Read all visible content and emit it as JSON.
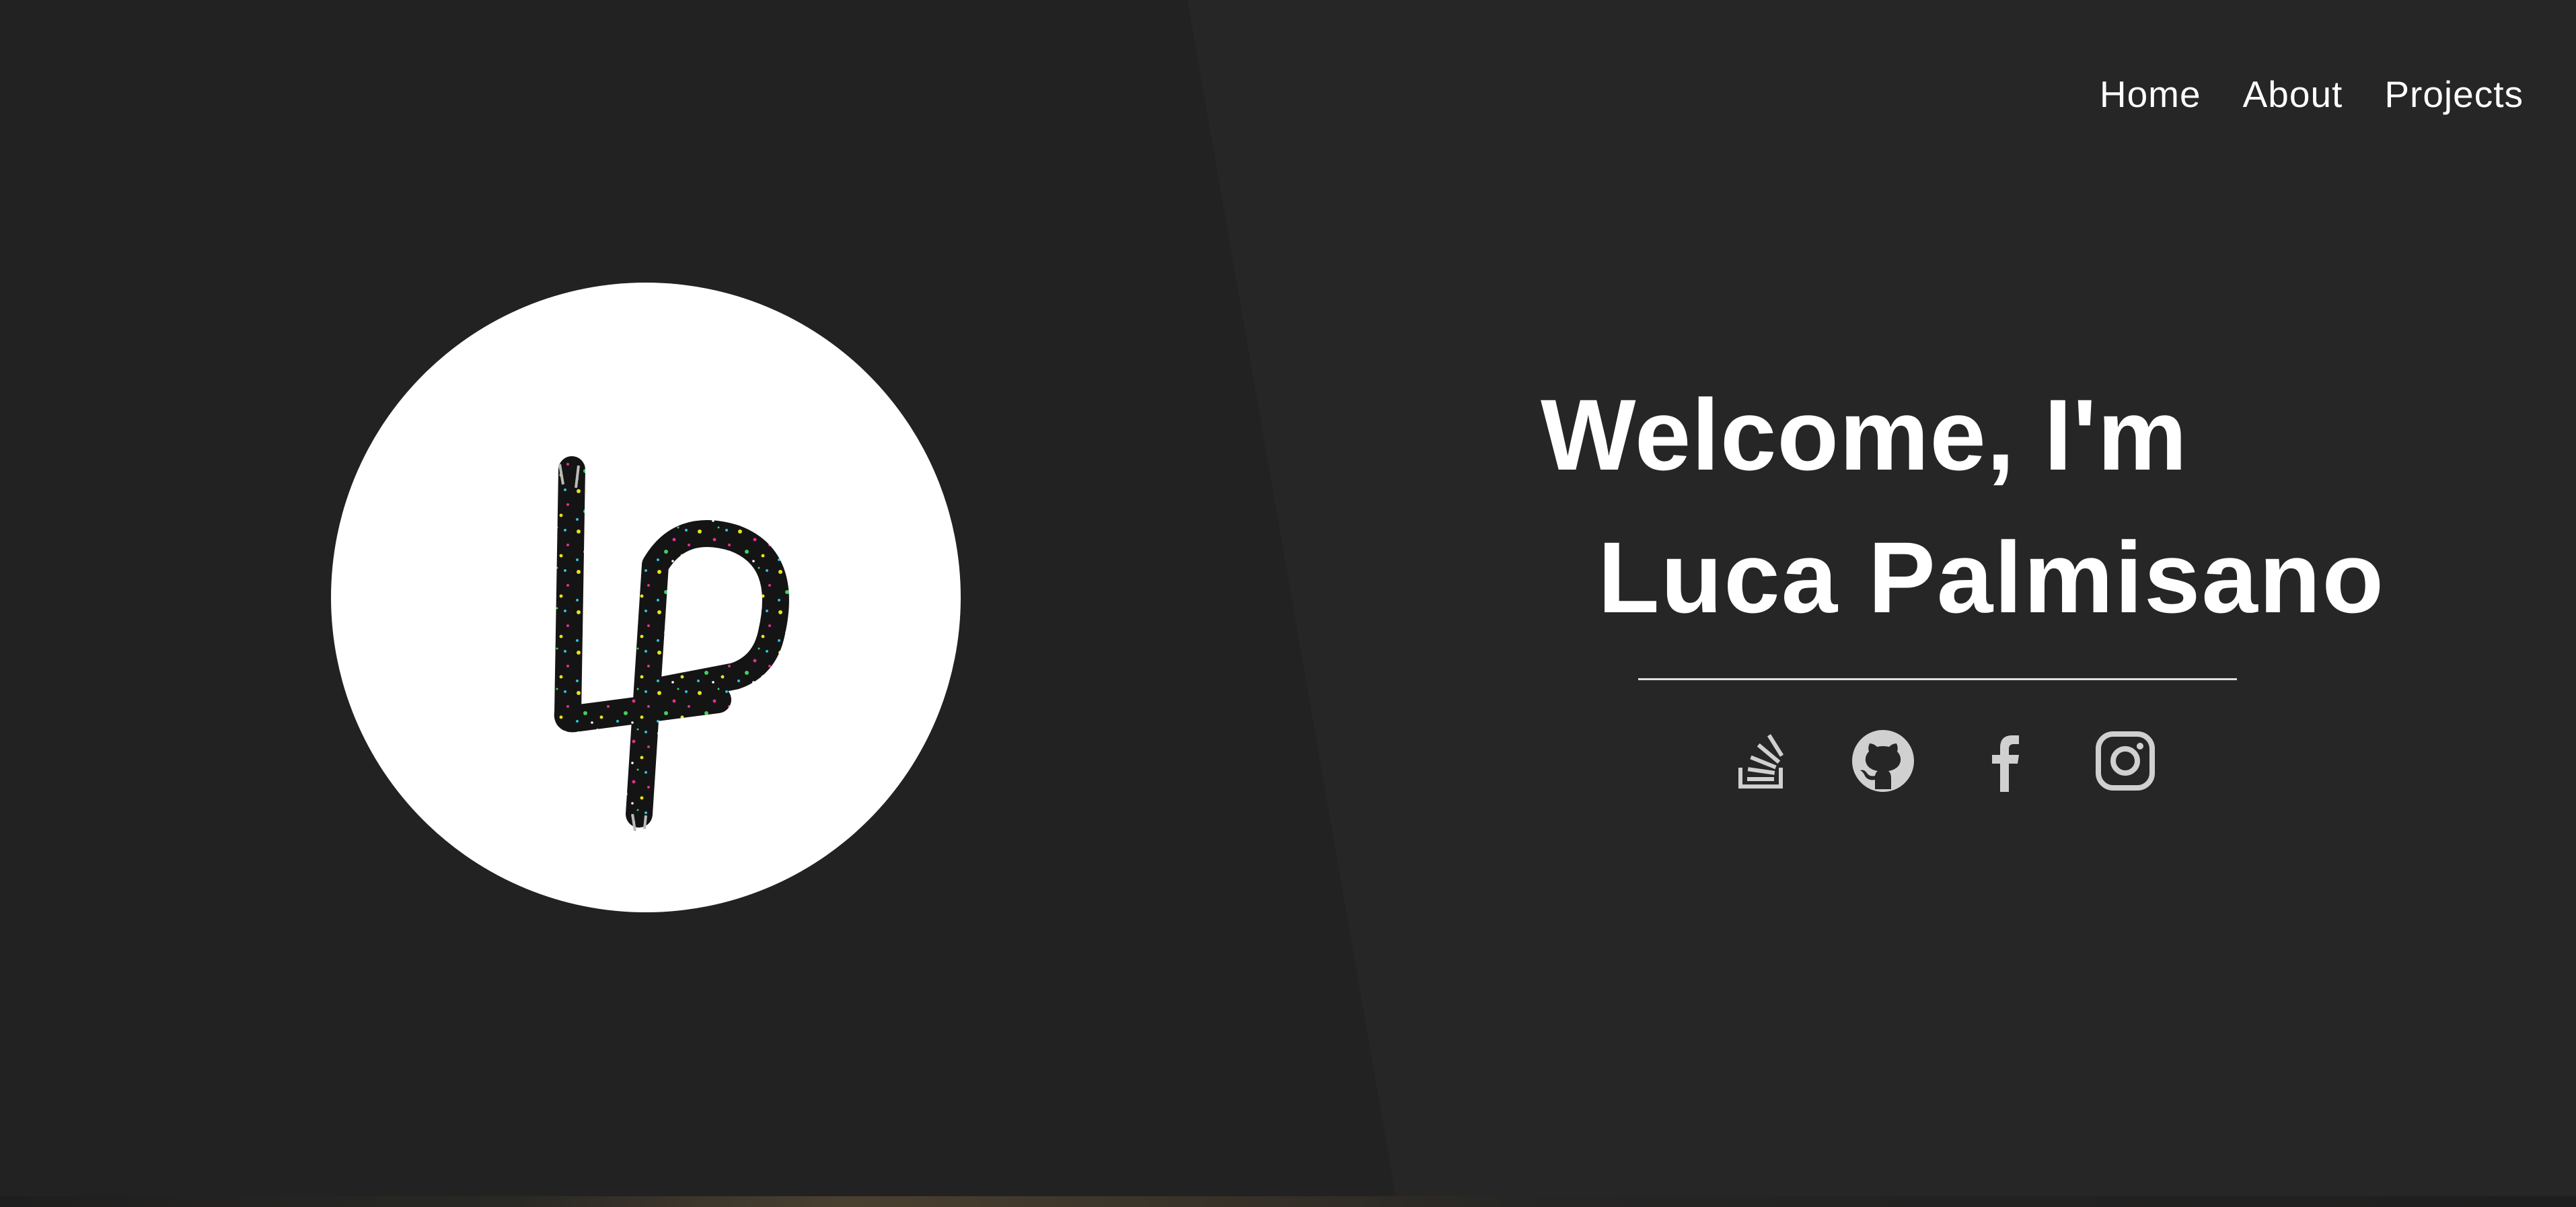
{
  "nav": {
    "items": [
      {
        "label": "Home"
      },
      {
        "label": "About"
      },
      {
        "label": "Projects"
      }
    ]
  },
  "logo": {
    "text": "LP"
  },
  "hero": {
    "line1": "Welcome, I'm",
    "line2": "Luca Palmisano"
  },
  "socials": [
    {
      "icon": "stack-overflow-icon"
    },
    {
      "icon": "github-icon"
    },
    {
      "icon": "facebook-icon"
    },
    {
      "icon": "instagram-icon"
    }
  ],
  "colors": {
    "background": "#262626",
    "panel": "#222222",
    "text": "#ffffff",
    "icon": "#d0d0d0"
  }
}
